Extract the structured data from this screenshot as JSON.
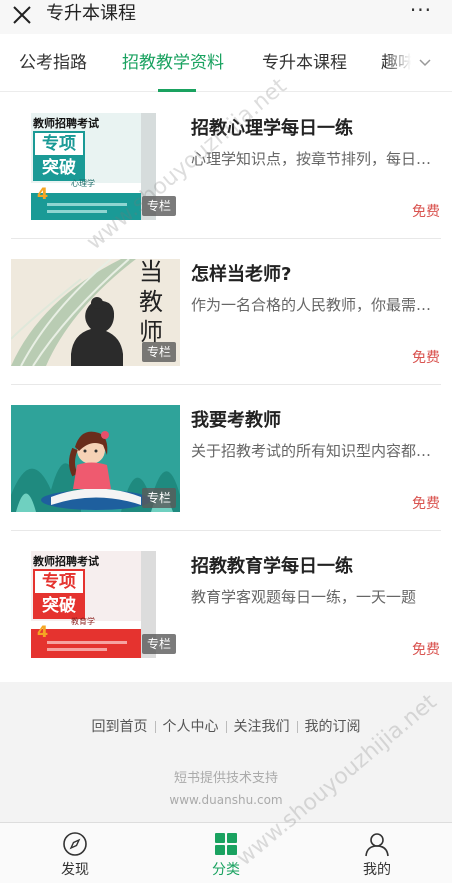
{
  "titlebar": {
    "title": "专升本课程",
    "more": "···"
  },
  "tabs": [
    {
      "label": "公考指路"
    },
    {
      "label": "招教教学资料"
    },
    {
      "label": "专升本课程"
    },
    {
      "label": "趣味"
    }
  ],
  "items": [
    {
      "title": "招教心理学每日一练",
      "desc": "心理学知识点，按章节排列，每日一练",
      "price": "免费",
      "badge": "专栏",
      "cover": {
        "top": "教师招聘考试",
        "main1": "专项",
        "main2": "突破",
        "sub": "心理学",
        "color": "#1a9a96"
      }
    },
    {
      "title": "怎样当老师?",
      "desc": "作为一名合格的人民教师，你最需要的是",
      "price": "免费",
      "badge": "专栏",
      "cover": {
        "chars": [
          "当",
          "教",
          "师"
        ]
      }
    },
    {
      "title": "我要考教师",
      "desc": "关于招教考试的所有知识型内容都在这里",
      "price": "免费",
      "badge": "专栏"
    },
    {
      "title": "招教教育学每日一练",
      "desc": "教育学客观题每日一练，一天一题",
      "price": "免费",
      "badge": "专栏",
      "cover": {
        "top": "教师招聘考试",
        "main1": "专项",
        "main2": "突破",
        "sub": "教育学",
        "color": "#e5332f"
      }
    }
  ],
  "footer": {
    "links": [
      "回到首页",
      "个人中心",
      "关注我们",
      "我的订阅"
    ],
    "powered": "短书提供技术支持",
    "site": "www.duanshu.com"
  },
  "nav": [
    {
      "label": "发现",
      "icon": "compass-icon"
    },
    {
      "label": "分类",
      "icon": "grid-icon"
    },
    {
      "label": "我的",
      "icon": "user-icon"
    }
  ],
  "watermark": "www.shouyouzhijia.net",
  "colors": {
    "accent": "#1aa260",
    "price": "#d9534f"
  }
}
